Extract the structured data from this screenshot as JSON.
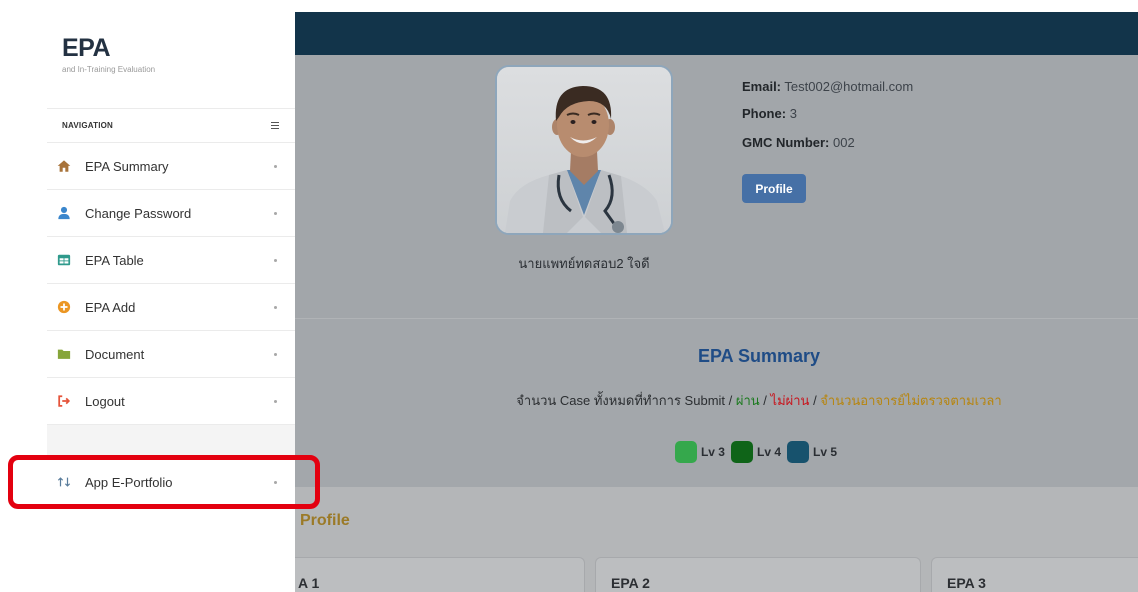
{
  "sidebar": {
    "brand": "EPA",
    "subtitle": "and In-Training Evaluation",
    "nav_heading": "NAVIGATION",
    "items": [
      {
        "label": "EPA Summary",
        "icon": "home-icon",
        "icon_color": "#a8733a"
      },
      {
        "label": "Change Password",
        "icon": "user-icon",
        "icon_color": "#3a86cc"
      },
      {
        "label": "EPA Table",
        "icon": "table-icon",
        "icon_color": "#2f9a8c"
      },
      {
        "label": "EPA Add",
        "icon": "plus-circle-icon",
        "icon_color": "#eb9623"
      },
      {
        "label": "Document",
        "icon": "folder-icon",
        "icon_color": "#86a53a"
      },
      {
        "label": "Logout",
        "icon": "sign-out-icon",
        "icon_color": "#e5533a"
      }
    ],
    "app_link": {
      "label": "App E-Portfolio",
      "icon": "exchange-icon",
      "icon_color": "#5a7d9c"
    }
  },
  "highlight": {
    "color": "#e3000f"
  },
  "header": {
    "color": "#12344a"
  },
  "profile": {
    "name": "นายแพทย์ทดสอบ2 ใจดี",
    "email_label": "Email:",
    "email": "Test002@hotmail.com",
    "phone_label": "Phone:",
    "phone": "3",
    "gmc_label": "GMC Number:",
    "gmc": "002",
    "profile_button": "Profile",
    "button_color": "#4670a6"
  },
  "summary": {
    "title": "EPA Summary",
    "title_color": "#1f4c86",
    "segments": [
      {
        "text": "จำนวน Case ทั้งหมดที่ทำการ Submit",
        "color": "#2b2e31"
      },
      {
        "text": " / ",
        "color": "#2b2e31"
      },
      {
        "text": "ผ่าน",
        "color": "#1b7a1e"
      },
      {
        "text": " / ",
        "color": "#2b2e31"
      },
      {
        "text": "ไม่ผ่าน",
        "color": "#c8141c"
      },
      {
        "text": " / ",
        "color": "#2b2e31"
      },
      {
        "text": "จำนวนอาจารย์ไม่ตรวจตามเวลา",
        "color": "#b7850e"
      }
    ],
    "levels": [
      {
        "label": "Lv 3",
        "color": "#35a84c"
      },
      {
        "label": "Lv 4",
        "color": "#0f6418"
      },
      {
        "label": "Lv 5",
        "color": "#17526d"
      }
    ]
  },
  "profile_section": {
    "title": "Profile",
    "title_color": "#9b7a27",
    "cards": [
      {
        "title": "A 1"
      },
      {
        "title": "EPA 2"
      },
      {
        "title": "EPA 3"
      }
    ]
  }
}
